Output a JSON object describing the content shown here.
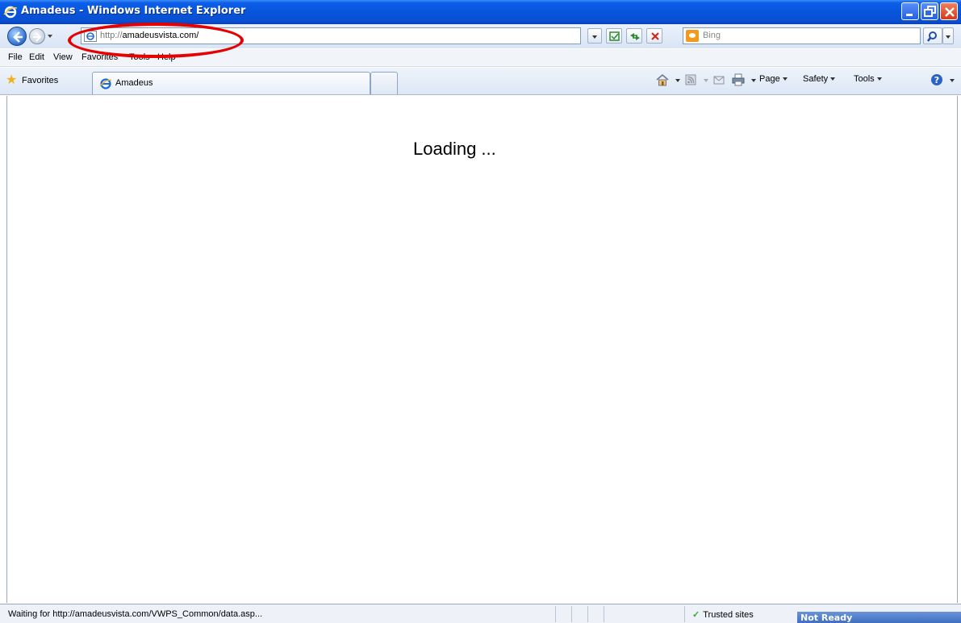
{
  "window": {
    "title": "Amadeus - Windows Internet Explorer"
  },
  "address_bar": {
    "url_scheme": "http://",
    "url_host": "amadeusvista.com/"
  },
  "search": {
    "placeholder": "Bing"
  },
  "menu": {
    "items": [
      "File",
      "Edit",
      "View",
      "Favorites",
      "Tools",
      "Help"
    ]
  },
  "favorites_bar": {
    "favorites_label": "Favorites",
    "tab_title": "Amadeus"
  },
  "command_bar": {
    "page_label": "Page",
    "safety_label": "Safety",
    "tools_label": "Tools"
  },
  "content": {
    "loading_text": "Loading ..."
  },
  "status_bar": {
    "status_text": "Waiting for http://amadeusvista.com/VWPS_Common/data.asp...",
    "zone": "Trusted sites",
    "notification": "Not Ready"
  },
  "annotations": {
    "highlight_color": "#e60000"
  },
  "colors": {
    "titlebar": "#0855dd"
  }
}
